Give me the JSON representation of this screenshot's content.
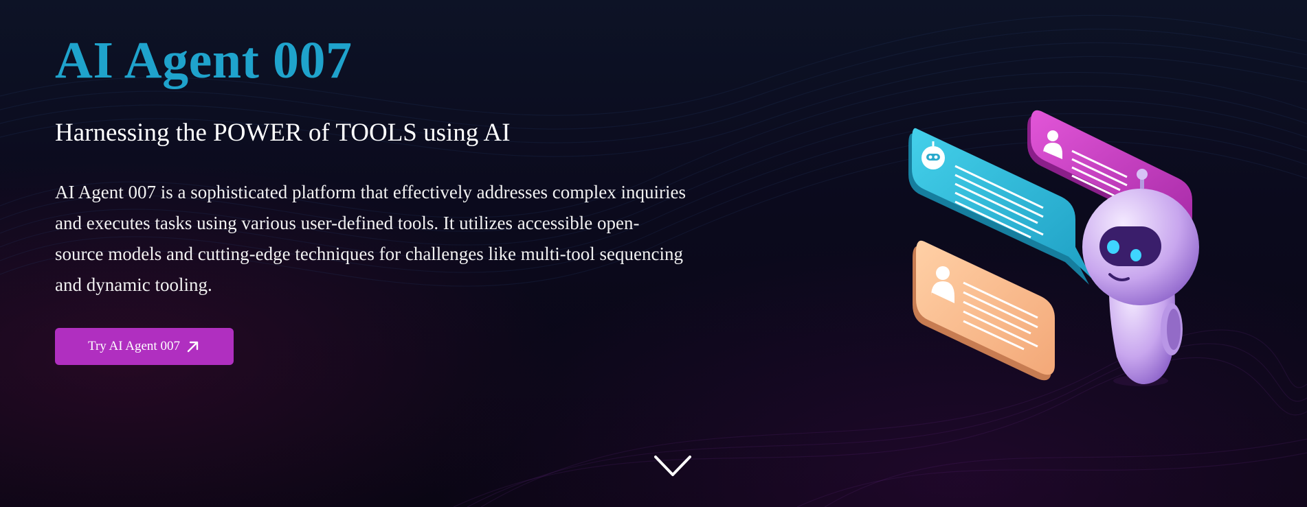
{
  "hero": {
    "title": "AI Agent 007",
    "subtitle": "Harnessing the POWER of TOOLS using AI",
    "description": "AI Agent 007 is a sophisticated platform that effectively addresses complex inquiries and executes tasks using various user-defined tools. It utilizes accessible open-source models and cutting-edge techniques for challenges like multi-tool sequencing and dynamic tooling.",
    "cta_label": "Try AI Agent 007",
    "cta_icon": "arrow-up-right-icon",
    "scroll_icon": "chevron-down-icon",
    "illustration": "robot-chat-illustration"
  },
  "colors": {
    "title": "#1fa3cc",
    "cta_background": "#b02fc0",
    "background": "#0c0818",
    "bubble_blue": "#2cb7d6",
    "bubble_pink": "#c83cc0",
    "bubble_orange": "#f6b98a",
    "robot": "#c9a9ee"
  }
}
